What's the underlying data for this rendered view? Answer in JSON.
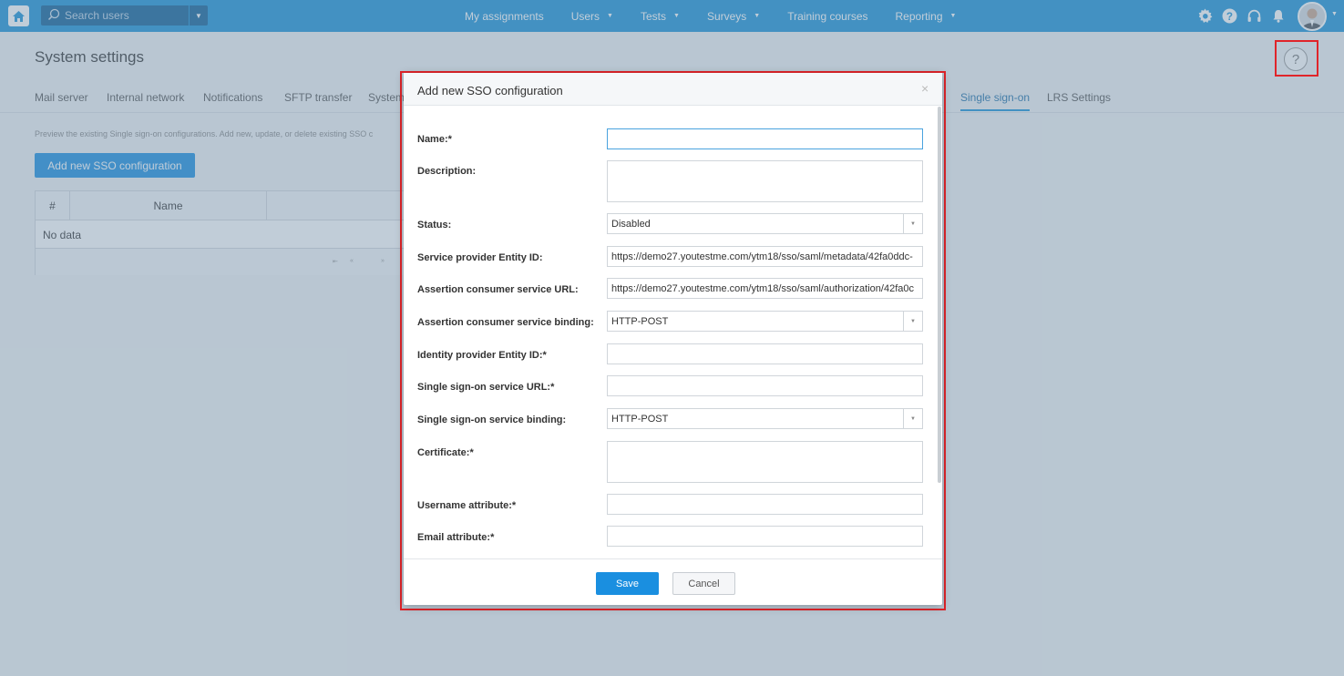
{
  "topbar": {
    "search_placeholder": "Search users",
    "nav": [
      {
        "label": "My assignments",
        "dropdown": false
      },
      {
        "label": "Users",
        "dropdown": true
      },
      {
        "label": "Tests",
        "dropdown": true
      },
      {
        "label": "Surveys",
        "dropdown": true
      },
      {
        "label": "Training courses",
        "dropdown": false
      },
      {
        "label": "Reporting",
        "dropdown": true
      }
    ],
    "icons": [
      "gear-icon",
      "help-icon",
      "headset-icon",
      "bell-icon"
    ],
    "accent_color": "#1a93d8"
  },
  "page": {
    "title": "System settings",
    "help_symbol": "?",
    "tabs": [
      {
        "label": "Mail server"
      },
      {
        "label": "Internal network"
      },
      {
        "label": "Notifications"
      },
      {
        "label": "SFTP transfer"
      },
      {
        "label": "System"
      },
      {
        "label": "Single sign-on",
        "active": true
      },
      {
        "label": "LRS Settings"
      }
    ],
    "info_text": "Preview the existing Single sign-on configurations. Add new, update, or delete existing SSO c",
    "add_button": "Add new SSO configuration",
    "grid": {
      "columns": [
        "#",
        "Name"
      ],
      "empty_text": "No data",
      "pager": [
        "⇤",
        "«",
        "»"
      ]
    }
  },
  "dialog": {
    "title": "Add new SSO configuration",
    "close_symbol": "×",
    "fields": {
      "name": {
        "label": "Name:*",
        "value": ""
      },
      "description": {
        "label": "Description:",
        "value": ""
      },
      "status": {
        "label": "Status:",
        "value": "Disabled"
      },
      "sp_entity_id": {
        "label": "Service provider Entity ID:",
        "value": "https://demo27.youtestme.com/ytm18/sso/saml/metadata/42fa0ddc-"
      },
      "acs_url": {
        "label": "Assertion consumer service URL:",
        "value": "https://demo27.youtestme.com/ytm18/sso/saml/authorization/42fa0c"
      },
      "acs_binding": {
        "label": "Assertion consumer service binding:",
        "value": "HTTP-POST"
      },
      "idp_entity_id": {
        "label": "Identity provider Entity ID:*",
        "value": ""
      },
      "sso_url": {
        "label": "Single sign-on service URL:*",
        "value": ""
      },
      "sso_binding": {
        "label": "Single sign-on service binding:",
        "value": "HTTP-POST"
      },
      "certificate": {
        "label": "Certificate:*",
        "value": ""
      },
      "username_attr": {
        "label": "Username attribute:*",
        "value": ""
      },
      "email_attr": {
        "label": "Email attribute:*",
        "value": ""
      }
    },
    "save_label": "Save",
    "cancel_label": "Cancel"
  },
  "highlight_color": "#e0242a"
}
